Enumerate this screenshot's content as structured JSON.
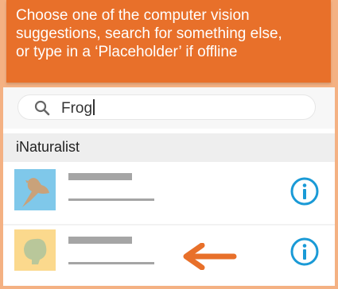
{
  "instruction": {
    "lines": [
      "Choose one of the computer vision",
      "suggestions, search for something else,",
      "or type in a  ‘Placeholder’ if offline"
    ]
  },
  "search": {
    "value": "Frog",
    "icon": "search-icon"
  },
  "source": {
    "label": "iNaturalist"
  },
  "results": [
    {
      "thumbnail": "bird-silhouette-icon",
      "thumb_color": "#7fc8ea",
      "action_icon": "info-icon"
    },
    {
      "thumbnail": "leaf-silhouette-icon",
      "thumb_color": "#fbd98d",
      "action_icon": "info-icon"
    }
  ],
  "colors": {
    "banner": "#e8702a",
    "accent_blue": "#1a9ad6",
    "arrow": "#e8702a",
    "placeholder_grey": "#a5a5a5"
  }
}
